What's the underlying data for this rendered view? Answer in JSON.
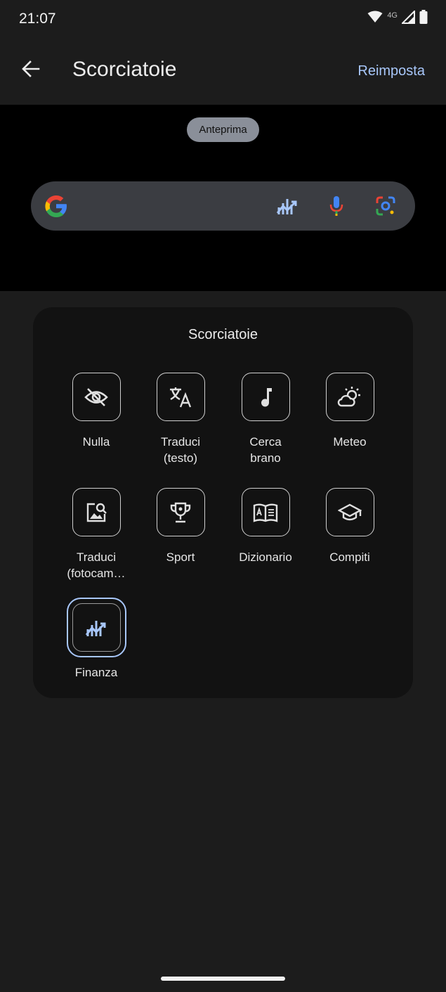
{
  "status_bar": {
    "time": "21:07",
    "network": "4G"
  },
  "app_bar": {
    "title": "Scorciatoie",
    "reset_label": "Reimposta"
  },
  "preview": {
    "chip_label": "Anteprima"
  },
  "panel": {
    "title": "Scorciatoie",
    "tiles": [
      {
        "label": "Nulla",
        "icon": "eye-off-icon"
      },
      {
        "label": "Traduci\n(testo)",
        "icon": "translate-icon"
      },
      {
        "label": "Cerca\nbrano",
        "icon": "music-note-icon"
      },
      {
        "label": "Meteo",
        "icon": "weather-icon"
      },
      {
        "label": "Traduci\n(fotocam…",
        "icon": "image-search-icon"
      },
      {
        "label": "Sport",
        "icon": "trophy-icon"
      },
      {
        "label": "Dizionario",
        "icon": "dictionary-icon"
      },
      {
        "label": "Compiti",
        "icon": "school-icon"
      },
      {
        "label": "Finanza",
        "icon": "finance-icon",
        "selected": true
      }
    ]
  },
  "colors": {
    "accent": "#a8c7fa",
    "background": "#1c1c1c",
    "panel": "#121212"
  }
}
